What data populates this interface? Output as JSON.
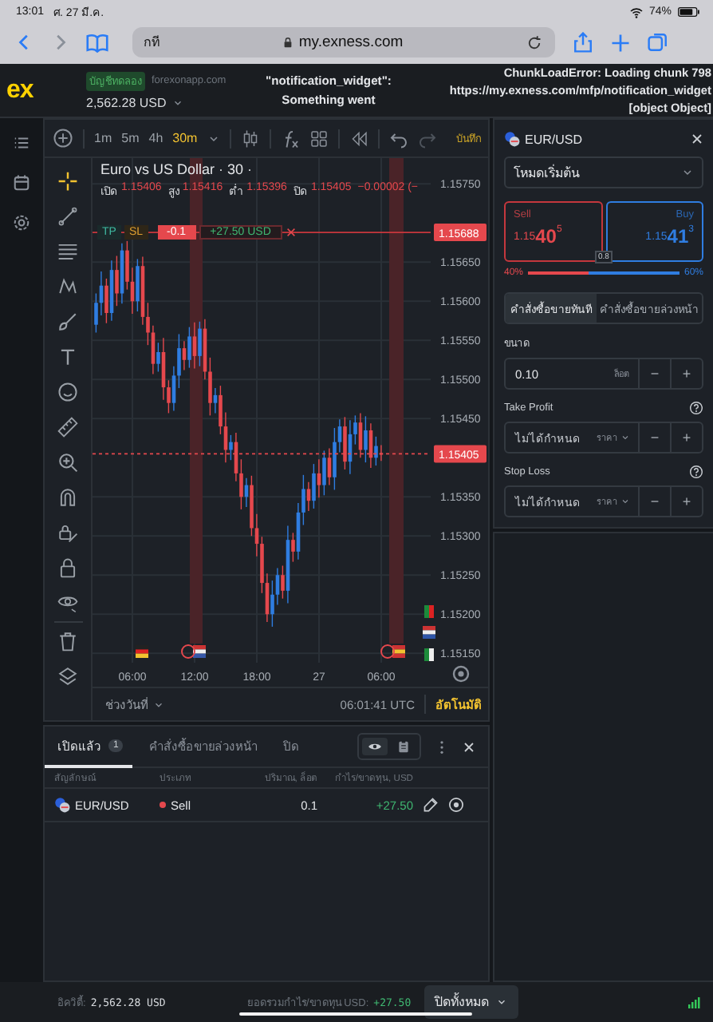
{
  "status_bar": {
    "time": "13:01",
    "date": "ศ. 27 มี.ค.",
    "battery": "74%"
  },
  "browser": {
    "text_size": "กที",
    "url": "my.exness.com"
  },
  "header": {
    "logo": "ex",
    "account_type": "บัญชีทดลอง",
    "site": "forexonapp.com",
    "balance": "2,562.28 USD",
    "error_left": [
      "\"notification_widget\":",
      "Something went"
    ],
    "error_right": [
      "ChunkLoadError: Loading chunk 798",
      "https://my.exness.com/mfp/notification_widget",
      "[object Object]"
    ]
  },
  "toolbar": {
    "timeframes": [
      {
        "label": "1m",
        "selected": false
      },
      {
        "label": "5m",
        "selected": false
      },
      {
        "label": "4h",
        "selected": false
      },
      {
        "label": "30m",
        "selected": true
      }
    ],
    "save": "บันทึก"
  },
  "tools": [
    {
      "kind": "crosshair",
      "selected": true
    },
    {
      "kind": "line",
      "selected": false
    },
    {
      "kind": "fib",
      "selected": false
    },
    {
      "kind": "pattern",
      "selected": false
    },
    {
      "kind": "brush",
      "selected": false
    },
    {
      "kind": "text",
      "selected": false
    },
    {
      "kind": "sticker",
      "selected": false
    },
    {
      "kind": "ruler",
      "selected": false
    },
    {
      "kind": "zoom",
      "selected": false
    },
    {
      "kind": "magnet",
      "selected": false
    },
    {
      "kind": "lockdraw",
      "selected": false
    },
    {
      "kind": "lock",
      "selected": false
    },
    {
      "kind": "eye",
      "selected": false
    },
    {
      "kind": "trash",
      "selected": false
    },
    {
      "kind": "layers",
      "selected": false
    }
  ],
  "chart": {
    "title": "Euro vs US Dollar · 30 ·",
    "ohlc": [
      {
        "label": "เปิด",
        "value": "1.15406"
      },
      {
        "label": "สูง",
        "value": "1.15416"
      },
      {
        "label": "ต่ำ",
        "value": "1.15396"
      },
      {
        "label": "ปิด",
        "value": "1.15405"
      }
    ],
    "change": "−0.00002 (−",
    "order_line": {
      "tp": "TP",
      "sl": "SL",
      "volume": "-0.1",
      "profit": "+27.50 USD",
      "price": "1.15688"
    },
    "chart_data": {
      "type": "candlestick",
      "categories": [
        null,
        null,
        null,
        null,
        null,
        null,
        null,
        "06:00",
        null,
        null,
        null,
        null,
        null,
        null,
        null,
        null,
        null,
        null,
        null,
        "12:00",
        null,
        null,
        null,
        null,
        null,
        null,
        null,
        null,
        null,
        null,
        null,
        "18:00",
        null,
        null,
        null,
        null,
        null,
        null,
        null,
        null,
        null,
        null,
        null,
        "27",
        null,
        null,
        null,
        null,
        null,
        null,
        null,
        null,
        null,
        null,
        null,
        "06:00"
      ],
      "ylim": [
        1.15138,
        1.15783
      ],
      "grid": true,
      "ref_lines": [
        {
          "axis": "y",
          "value": 1.15688,
          "color": "#c8373d"
        },
        {
          "axis": "y",
          "value": 1.15405,
          "color": "#e5484d"
        }
      ],
      "yticks": [
        {
          "value": 1.1575,
          "label": "1.15750"
        },
        {
          "value": 1.1565,
          "label": "1.15650"
        },
        {
          "value": 1.156,
          "label": "1.15600"
        },
        {
          "value": 1.1555,
          "label": "1.15550"
        },
        {
          "value": 1.155,
          "label": "1.15500"
        },
        {
          "value": 1.1545,
          "label": "1.15450"
        },
        {
          "value": 1.1535,
          "label": "1.15350"
        },
        {
          "value": 1.153,
          "label": "1.15300"
        },
        {
          "value": 1.1525,
          "label": "1.15250"
        },
        {
          "value": 1.152,
          "label": "1.15200"
        },
        {
          "value": 1.1515,
          "label": "1.15150"
        }
      ],
      "ohlc": [
        [
          1.1557,
          1.1561,
          1.1556,
          1.15598
        ],
        [
          1.15598,
          1.15638,
          1.15582,
          1.1562
        ],
        [
          1.1562,
          1.15629,
          1.15572,
          1.15585
        ],
        [
          1.15585,
          1.15652,
          1.15575,
          1.1564
        ],
        [
          1.1564,
          1.15658,
          1.15594,
          1.1561
        ],
        [
          1.1561,
          1.15674,
          1.15597,
          1.15665
        ],
        [
          1.15665,
          1.15677,
          1.15615,
          1.15625
        ],
        [
          1.15625,
          1.15643,
          1.15584,
          1.156
        ],
        [
          1.156,
          1.15654,
          1.15587,
          1.15645
        ],
        [
          1.15645,
          1.15657,
          1.1557,
          1.1558
        ],
        [
          1.1558,
          1.15598,
          1.15544,
          1.1556
        ],
        [
          1.1556,
          1.15569,
          1.15507,
          1.1552
        ],
        [
          1.1552,
          1.15547,
          1.1551,
          1.15535
        ],
        [
          1.15535,
          1.15553,
          1.15474,
          1.1549
        ],
        [
          1.1549,
          1.15499,
          1.15457,
          1.1547
        ],
        [
          1.1547,
          1.15517,
          1.1546,
          1.15505
        ],
        [
          1.15505,
          1.15558,
          1.15489,
          1.1554
        ],
        [
          1.1554,
          1.15549,
          1.15512,
          1.15525
        ],
        [
          1.15525,
          1.15567,
          1.15515,
          1.15555
        ],
        [
          1.15555,
          1.15573,
          1.15514,
          1.1553
        ],
        [
          1.1553,
          1.15574,
          1.15517,
          1.15565
        ],
        [
          1.15565,
          1.15577,
          1.155,
          1.1551
        ],
        [
          1.1551,
          1.15528,
          1.15454,
          1.1547
        ],
        [
          1.1547,
          1.15489,
          1.15457,
          1.1548
        ],
        [
          1.1548,
          1.15492,
          1.1543,
          1.1544
        ],
        [
          1.1544,
          1.15458,
          1.15394,
          1.1541
        ],
        [
          1.1541,
          1.15429,
          1.15397,
          1.1542
        ],
        [
          1.1542,
          1.15432,
          1.1537,
          1.1538
        ],
        [
          1.1538,
          1.15398,
          1.15334,
          1.1535
        ],
        [
          1.1535,
          1.15374,
          1.15337,
          1.15365
        ],
        [
          1.15365,
          1.15377,
          1.153,
          1.1531
        ],
        [
          1.1531,
          1.15328,
          1.15274,
          1.1529
        ],
        [
          1.1529,
          1.15299,
          1.15227,
          1.1524
        ],
        [
          1.1524,
          1.15252,
          1.1519,
          1.152
        ],
        [
          1.152,
          1.15243,
          1.15184,
          1.15225
        ],
        [
          1.15225,
          1.15259,
          1.15212,
          1.1525
        ],
        [
          1.1525,
          1.15262,
          1.1522,
          1.1523
        ],
        [
          1.1523,
          1.15313,
          1.15214,
          1.15295
        ],
        [
          1.15295,
          1.15304,
          1.15267,
          1.1528
        ],
        [
          1.1528,
          1.15342,
          1.1527,
          1.1533
        ],
        [
          1.1533,
          1.15378,
          1.15314,
          1.1536
        ],
        [
          1.1536,
          1.15369,
          1.15332,
          1.15345
        ],
        [
          1.15345,
          1.15392,
          1.15335,
          1.1538
        ],
        [
          1.1538,
          1.15398,
          1.15349,
          1.15365
        ],
        [
          1.15365,
          1.15409,
          1.15352,
          1.154
        ],
        [
          1.154,
          1.15412,
          1.15365,
          1.15375
        ],
        [
          1.15375,
          1.15438,
          1.15359,
          1.1542
        ],
        [
          1.1542,
          1.15449,
          1.15407,
          1.1544
        ],
        [
          1.1544,
          1.15452,
          1.15385,
          1.15395
        ],
        [
          1.15395,
          1.15448,
          1.15379,
          1.1543
        ],
        [
          1.1543,
          1.15454,
          1.15417,
          1.15445
        ],
        [
          1.15445,
          1.15457,
          1.154,
          1.1541
        ],
        [
          1.1541,
          1.15453,
          1.15394,
          1.15435
        ],
        [
          1.15435,
          1.15444,
          1.15387,
          1.154
        ],
        [
          1.154,
          1.15427,
          1.1539,
          1.15415
        ],
        [
          1.15406,
          1.15416,
          1.15396,
          1.15405
        ]
      ]
    },
    "current_price": "1.15405",
    "range": "ช่วงวันที่",
    "clock": "06:01:41 UTC",
    "auto": "อัตโนมัติ"
  },
  "trade_panel": {
    "symbol": "EUR/USD",
    "mode": "โหมดเริ่มต้น",
    "sell": {
      "label": "Sell",
      "price_main": "1.15",
      "price_big": "40",
      "price_sup": "5"
    },
    "buy": {
      "label": "Buy",
      "price_main": "1.15",
      "price_big": "41",
      "price_sup": "3"
    },
    "spread": "0.8",
    "sentiment": {
      "sell_pct": "40%",
      "buy_pct": "60%",
      "level": 0.4
    },
    "order_types": [
      {
        "label": "คำสั่งซื้อขายทันที",
        "selected": true
      },
      {
        "label": "คำสั่งซื้อขายล่วงหน้า",
        "selected": false
      }
    ],
    "fields": [
      {
        "kind": "volume",
        "label": "ขนาด",
        "value": "0.10",
        "unit": "ล็อต",
        "minus": "−",
        "plus": "+"
      },
      {
        "kind": "price",
        "label": "Take Profit",
        "placeholder": "ไม่ได้กำหนด",
        "unit": "ราคา",
        "minus": "−",
        "plus": "+"
      },
      {
        "kind": "price",
        "label": "Stop Loss",
        "placeholder": "ไม่ได้กำหนด",
        "unit": "ราคา",
        "minus": "−",
        "plus": "+"
      }
    ]
  },
  "positions": {
    "tabs": [
      {
        "label": "เปิดแล้ว",
        "count": "1",
        "selected": true
      },
      {
        "label": "คำสั่งซื้อขายล่วงหน้า",
        "selected": false
      },
      {
        "label": "ปิด",
        "selected": false
      }
    ],
    "view_modes": [
      {
        "kind": "eye",
        "selected": true
      },
      {
        "kind": "clipboard",
        "selected": false
      }
    ],
    "columns": [
      "สัญลักษณ์",
      "ประเภท",
      "ปริมาณ, ล็อต",
      "กำไร/ขาดทุน, USD"
    ],
    "rows": [
      {
        "symbol": "EUR/USD",
        "type": "Sell",
        "color": "#e5484d",
        "volume": "0.1",
        "profit": "+27.50"
      }
    ]
  },
  "footer": {
    "equity_label": "อิควิตี้:",
    "equity": "2,562.28 USD",
    "total_label": "ยอดรวมกำไร/ขาดทุน USD:",
    "total": "+27.50",
    "close_all": "ปิดทั้งหมด"
  }
}
